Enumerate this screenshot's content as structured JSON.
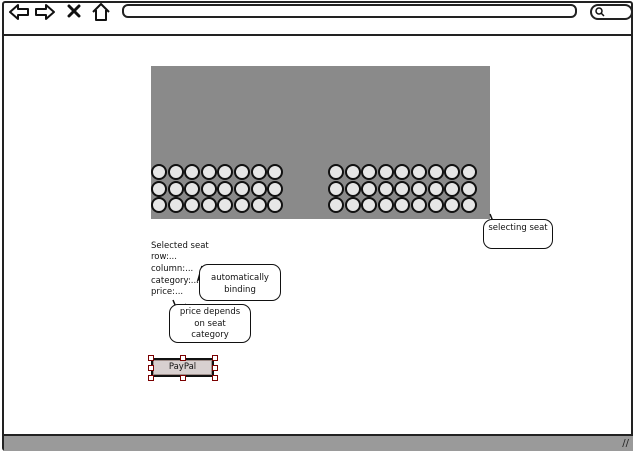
{
  "browser": {
    "icons": [
      "back-arrow-icon",
      "forward-arrow-icon",
      "close-icon",
      "home-icon"
    ],
    "search_icon": "search-icon"
  },
  "selection_info": {
    "heading": "Selected seat",
    "row_label": "row:...",
    "column_label": "column:...",
    "category_label": "category:...",
    "price_label": "price:..."
  },
  "annotations": {
    "selecting_seat": "selecting seat",
    "automatically_binding": "automatically binding",
    "price_note": "price depends on seat category"
  },
  "paypal_button": {
    "label": "PayPal"
  },
  "seat_map": {
    "left_block": {
      "rows": 3,
      "cols": 8
    },
    "right_block": {
      "rows": 3,
      "cols": 9
    }
  },
  "colors": {
    "stage": "#8a8a8a",
    "seat_fill": "#e6e6e6",
    "statusbar": "#9a9a9a"
  }
}
